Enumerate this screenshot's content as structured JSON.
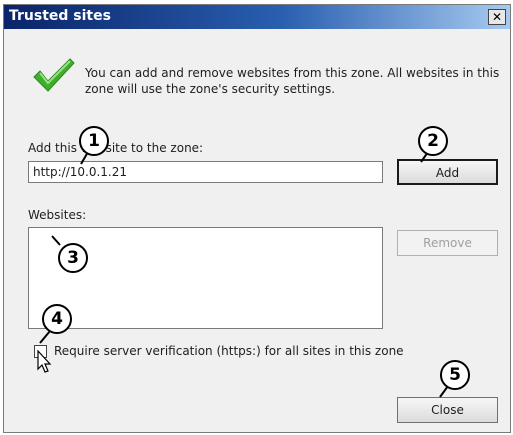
{
  "window": {
    "title": "Trusted sites",
    "close_glyph": "✕"
  },
  "info": {
    "icon": "checkmark-icon",
    "text": "You can add and remove websites from this zone. All websites in this zone will use the zone's security settings."
  },
  "add_site": {
    "label": "Add this website to the zone:",
    "value": "http://10.0.1.21",
    "add_button": "Add"
  },
  "websites": {
    "label": "Websites:",
    "items": [],
    "remove_button": "Remove"
  },
  "verification": {
    "label": "Require server verification (https:) for all sites in this zone",
    "checked": false
  },
  "footer": {
    "close_button": "Close"
  },
  "callouts": [
    "1",
    "2",
    "3",
    "4",
    "5"
  ],
  "colors": {
    "titlebar_start": "#0a246a",
    "titlebar_end": "#a6caf0",
    "check_green": "#3fae2a"
  }
}
